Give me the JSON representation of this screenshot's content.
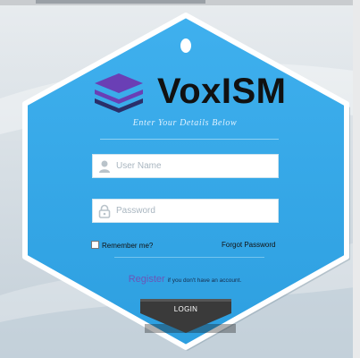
{
  "brand": {
    "name": "VoxISM",
    "tagline": "Enter Your Details Below"
  },
  "form": {
    "username_placeholder": "User Name",
    "password_placeholder": "Password",
    "remember_label": "Remember me?",
    "forgot_label": "Forgot Password"
  },
  "register": {
    "link_label": "Register",
    "rest": "if you don't have an account."
  },
  "login_button": {
    "label": "LOGIN"
  },
  "colors": {
    "card_blue": "#35a8e8",
    "logo_purple": "#6a3fb5",
    "logo_navy": "#2a2f6a",
    "register_link": "#6b55b8",
    "button_dark": "#3a3a3a"
  },
  "icons": [
    "user-icon",
    "lock-icon",
    "logo-layers-icon"
  ]
}
